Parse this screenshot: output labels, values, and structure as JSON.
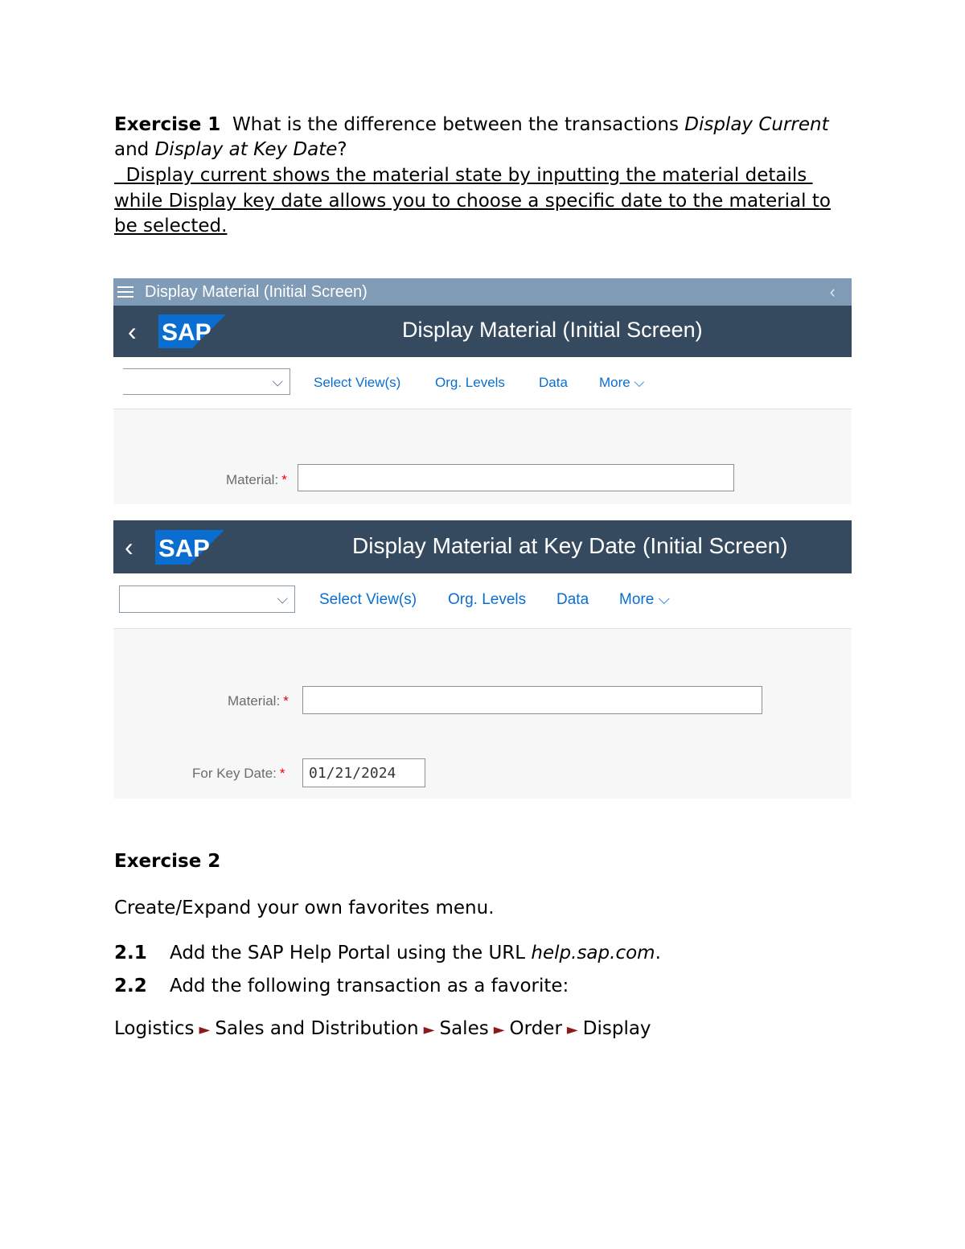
{
  "exercise1": {
    "label": "Exercise 1",
    "q_part1": "What is the difference between the transactions ",
    "q_italic1": "Display Current",
    "q_and": "and ",
    "q_italic2": "Display at Key Date",
    "q_end": "?",
    "answer_line1": "  Display current shows the material state by inputting the material details ",
    "answer_line2": "while Display key date allows you to choose a specific date to the material to",
    "answer_line3": "be selected."
  },
  "screen1": {
    "window_title": "Display Material (Initial Screen)",
    "logo_text": "SAP",
    "shell_title": "Display Material (Initial Screen)",
    "toolbar": [
      "Select View(s)",
      "Org. Levels",
      "Data",
      "More"
    ],
    "material_label": "Material:",
    "required_mark": "*"
  },
  "screen2": {
    "logo_text": "SAP",
    "shell_title": "Display Material at Key Date (Initial Screen)",
    "toolbar": [
      "Select View(s)",
      "Org. Levels",
      "Data",
      "More"
    ],
    "material_label": "Material:",
    "key_date_label": "For Key Date:",
    "key_date_value": "01/21/2024",
    "required_mark": "*"
  },
  "exercise2": {
    "label": "Exercise 2",
    "intro": "Create/Expand your own favorites menu.",
    "step1_num": "2.1",
    "step1_text": "Add the SAP Help Portal using the URL ",
    "step1_url": "help.sap.com",
    "step1_end": ".",
    "step2_num": "2.2",
    "step2_text": "Add the following transaction as a favorite:",
    "path": [
      "Logistics",
      "Sales and Distribution",
      "Sales",
      "Order",
      "Display"
    ]
  },
  "colors": {
    "shell": "#354a5f",
    "titlebar": "#7f9bb6",
    "link": "#0a6ed1",
    "logo": "#0a6ed1",
    "arrow": "#8b1a1a"
  },
  "icons": [
    "hamburger-icon",
    "back-chevron-icon",
    "dropdown-chevron-icon",
    "path-arrow-icon"
  ]
}
